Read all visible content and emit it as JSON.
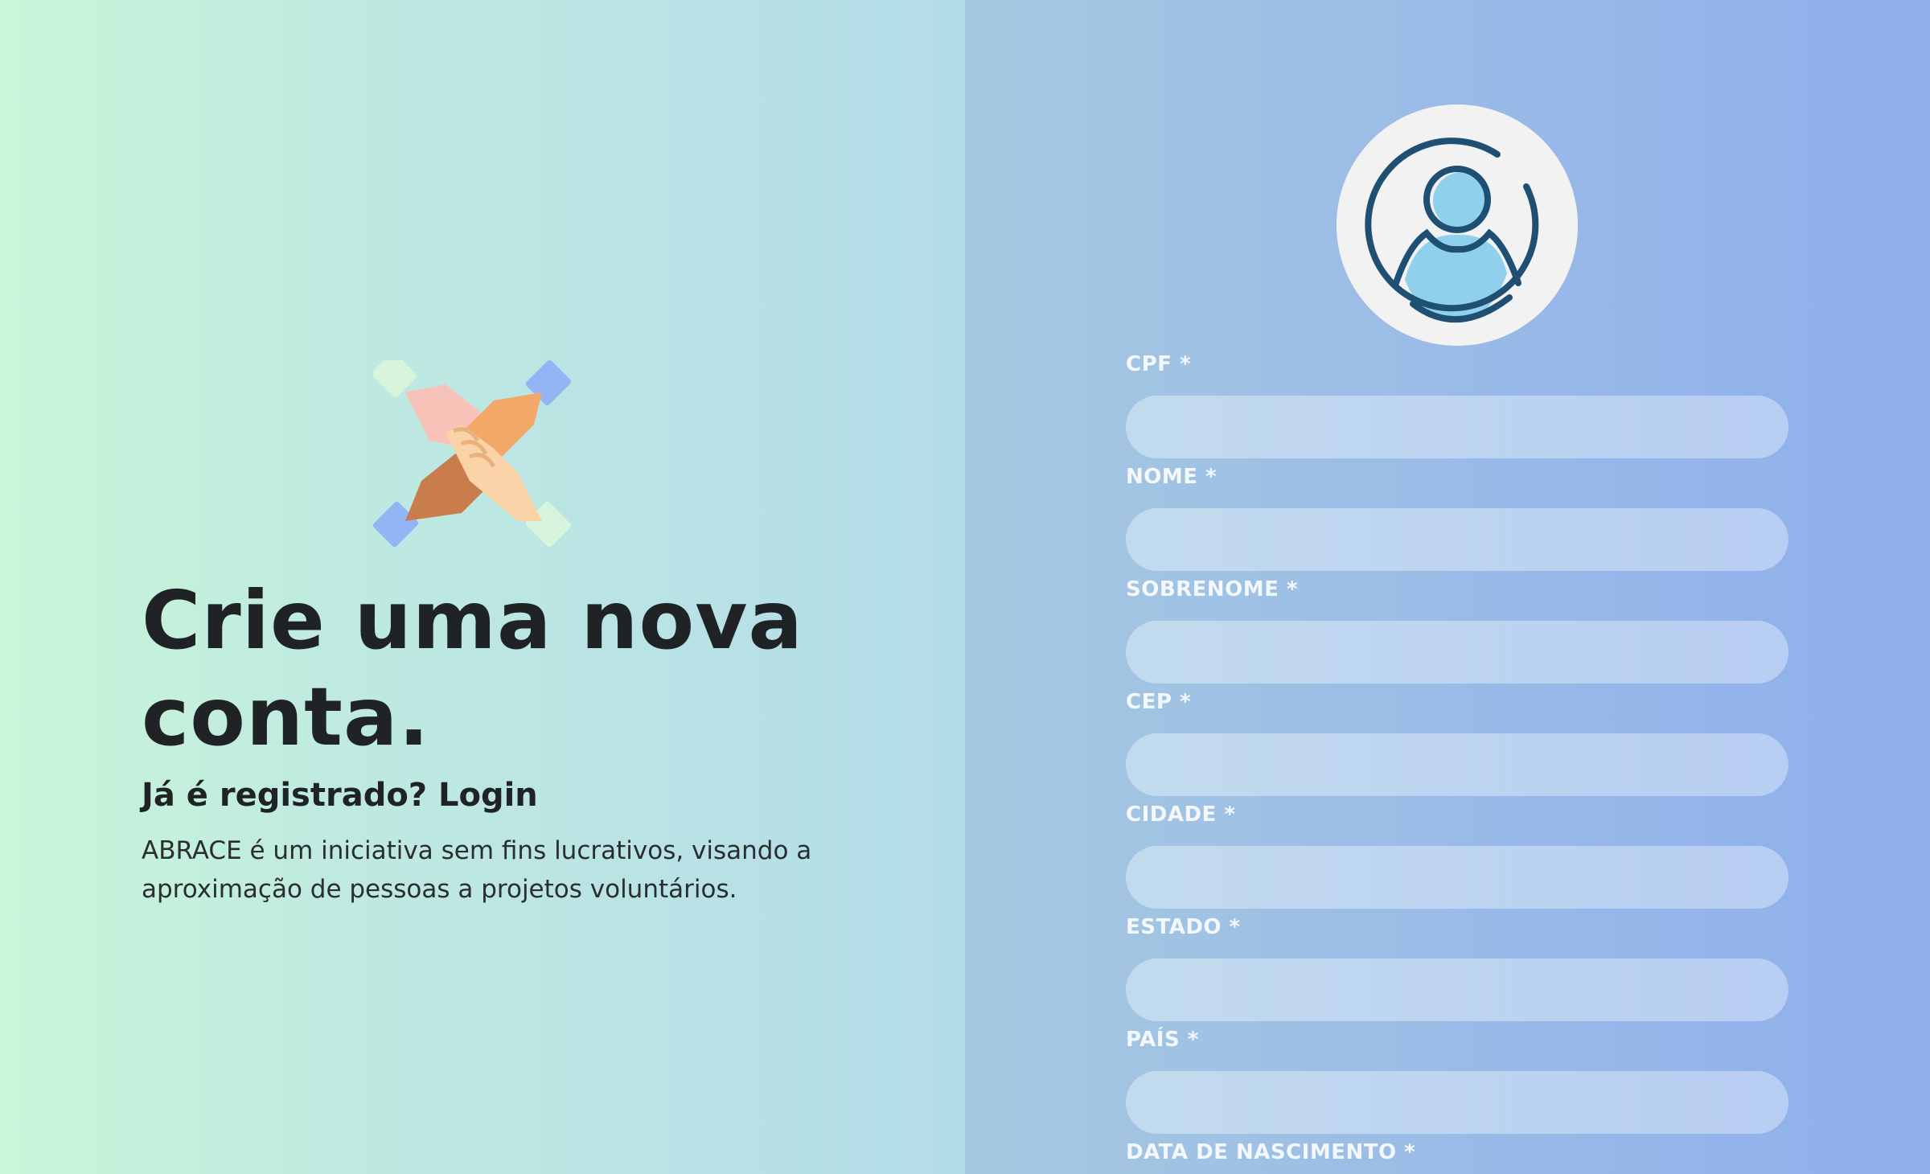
{
  "hero": {
    "title": "Crie uma nova conta.",
    "already_registered": "Já é registrado?",
    "login_link": "Login",
    "description": "ABRACE é um iniciativa sem fins lucrativos, visando a aproximação de pessoas a projetos voluntários.",
    "logo_icon": "stacked-hands-icon"
  },
  "form": {
    "avatar_icon": "user-avatar-icon",
    "fields": [
      {
        "label": "CPF *",
        "value": ""
      },
      {
        "label": "NOME *",
        "value": ""
      },
      {
        "label": "SOBRENOME *",
        "value": ""
      },
      {
        "label": "CEP *",
        "value": ""
      },
      {
        "label": "CIDADE *",
        "value": ""
      },
      {
        "label": "ESTADO *",
        "value": ""
      },
      {
        "label": "PAÍS *",
        "value": ""
      },
      {
        "label": "DATA DE NASCIMENTO *",
        "value": ""
      }
    ]
  },
  "colors": {
    "left_gradient_start": "#c9f6d9",
    "left_gradient_end": "#b3dce9",
    "right_gradient_start": "#a6c9e0",
    "right_gradient_end": "#8eaeec",
    "heading_text": "#1f2326",
    "label_text": "#f4f7fb",
    "avatar_stroke": "#1f4f73",
    "avatar_fill": "#8fd1ec"
  }
}
